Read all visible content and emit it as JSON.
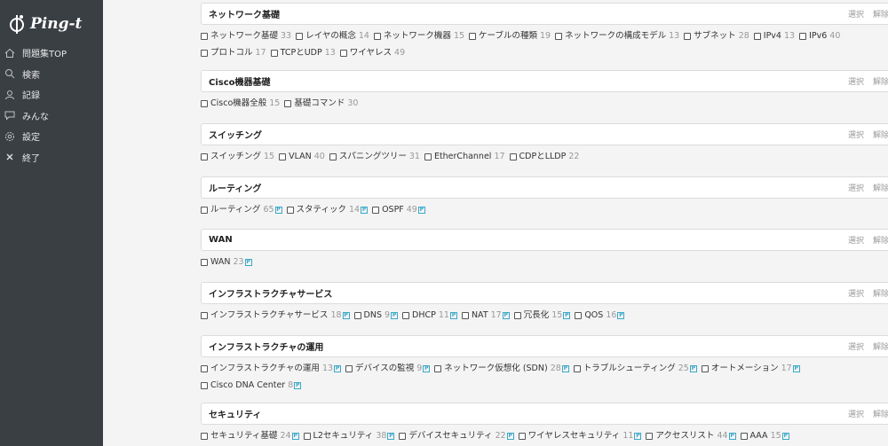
{
  "app": {
    "logo_text": "Ping-t"
  },
  "sidebar": {
    "items": [
      {
        "label": "問題集TOP",
        "icon": "home-icon"
      },
      {
        "label": "検索",
        "icon": "search-icon"
      },
      {
        "label": "記録",
        "icon": "user-icon"
      },
      {
        "label": "みんな",
        "icon": "chat-icon"
      },
      {
        "label": "設定",
        "icon": "gear-icon"
      },
      {
        "label": "終了",
        "icon": "close-icon"
      }
    ]
  },
  "actions": {
    "select": "選択",
    "clear": "解除"
  },
  "badge_letter": "P",
  "colors": {
    "sidebar_bg": "#3a3f44",
    "badge": "#3aa8c8",
    "page_bg": "#f4f4f4"
  },
  "sections": [
    {
      "title": "ネットワーク基礎",
      "topics": [
        {
          "label": "ネットワーク基礎",
          "count": "33"
        },
        {
          "label": "レイヤの概念",
          "count": "14"
        },
        {
          "label": "ネットワーク機器",
          "count": "15"
        },
        {
          "label": "ケーブルの種類",
          "count": "19"
        },
        {
          "label": "ネットワークの構成モデル",
          "count": "13"
        },
        {
          "label": "サブネット",
          "count": "28"
        },
        {
          "label": "IPv4",
          "count": "13"
        },
        {
          "label": "IPv6",
          "count": "40"
        },
        {
          "label": "プロトコル",
          "count": "17"
        },
        {
          "label": "TCPとUDP",
          "count": "13"
        },
        {
          "label": "ワイヤレス",
          "count": "49"
        }
      ]
    },
    {
      "title": "Cisco機器基礎",
      "topics": [
        {
          "label": "Cisco機器全般",
          "count": "15"
        },
        {
          "label": "基礎コマンド",
          "count": "30"
        }
      ]
    },
    {
      "title": "スイッチング",
      "topics": [
        {
          "label": "スイッチング",
          "count": "15"
        },
        {
          "label": "VLAN",
          "count": "40"
        },
        {
          "label": "スパニングツリー",
          "count": "31"
        },
        {
          "label": "EtherChannel",
          "count": "17"
        },
        {
          "label": "CDPとLLDP",
          "count": "22"
        }
      ]
    },
    {
      "title": "ルーティング",
      "topics": [
        {
          "label": "ルーティング",
          "count": "65",
          "badge": true
        },
        {
          "label": "スタティック",
          "count": "14",
          "badge": true
        },
        {
          "label": "OSPF",
          "count": "49",
          "badge": true
        }
      ]
    },
    {
      "title": "WAN",
      "topics": [
        {
          "label": "WAN",
          "count": "23",
          "badge": true
        }
      ]
    },
    {
      "title": "インフラストラクチャサービス",
      "topics": [
        {
          "label": "インフラストラクチャサービス",
          "count": "18",
          "badge": true
        },
        {
          "label": "DNS",
          "count": "9",
          "badge": true
        },
        {
          "label": "DHCP",
          "count": "11",
          "badge": true
        },
        {
          "label": "NAT",
          "count": "17",
          "badge": true
        },
        {
          "label": "冗長化",
          "count": "15",
          "badge": true
        },
        {
          "label": "QOS",
          "count": "16",
          "badge": true
        }
      ]
    },
    {
      "title": "インフラストラクチャの運用",
      "topics": [
        {
          "label": "インフラストラクチャの運用",
          "count": "13",
          "badge": true
        },
        {
          "label": "デバイスの監視",
          "count": "9",
          "badge": true
        },
        {
          "label": "ネットワーク仮想化 (SDN)",
          "count": "28",
          "badge": true
        },
        {
          "label": "トラブルシューティング",
          "count": "25",
          "badge": true
        },
        {
          "label": "オートメーション",
          "count": "17",
          "badge": true
        },
        {
          "label": "Cisco DNA Center",
          "count": "8",
          "badge": true
        }
      ]
    },
    {
      "title": "セキュリティ",
      "topics": [
        {
          "label": "セキュリティ基礎",
          "count": "24",
          "badge": true
        },
        {
          "label": "L2セキュリティ",
          "count": "38",
          "badge": true
        },
        {
          "label": "デバイスセキュリティ",
          "count": "22",
          "badge": true
        },
        {
          "label": "ワイヤレスセキュリティ",
          "count": "11",
          "badge": true
        },
        {
          "label": "アクセスリスト",
          "count": "44",
          "badge": true
        },
        {
          "label": "AAA",
          "count": "15",
          "badge": true
        }
      ]
    }
  ]
}
